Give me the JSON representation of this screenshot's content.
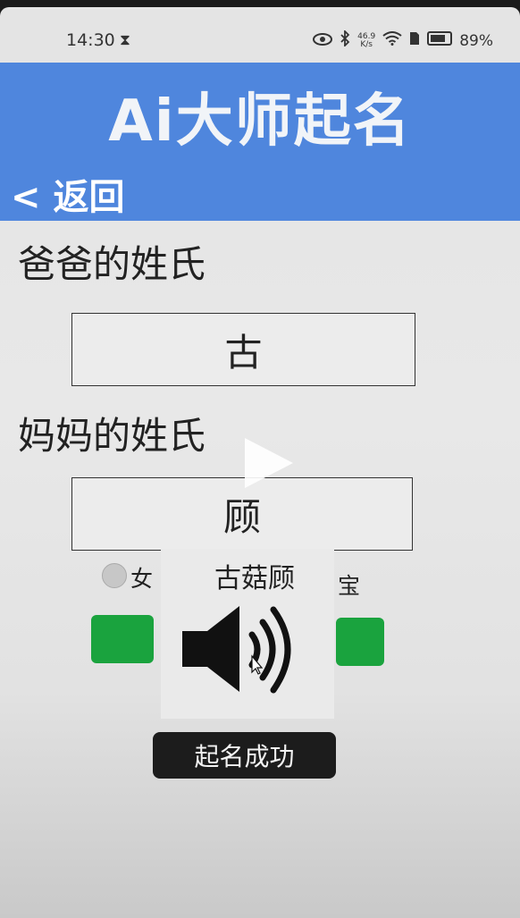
{
  "status_bar": {
    "time": "14:30",
    "net_speed_value": "46.9",
    "net_speed_unit": "K/s",
    "battery_percent": "89%"
  },
  "header": {
    "title": "Ai大师起名",
    "back_label": "< 返回"
  },
  "form": {
    "father_label": "爸爸的姓氏",
    "father_surname": "古",
    "mother_label": "妈妈的姓氏",
    "mother_surname": "顾",
    "gender_female": "女",
    "gender_baby_partial": "宝"
  },
  "result": {
    "generated_name": "古菇顾"
  },
  "toast": {
    "message": "起名成功"
  },
  "colors": {
    "header_bg": "#4f86dd",
    "button_green": "#1aa33e",
    "toast_bg": "#1c1c1c"
  }
}
